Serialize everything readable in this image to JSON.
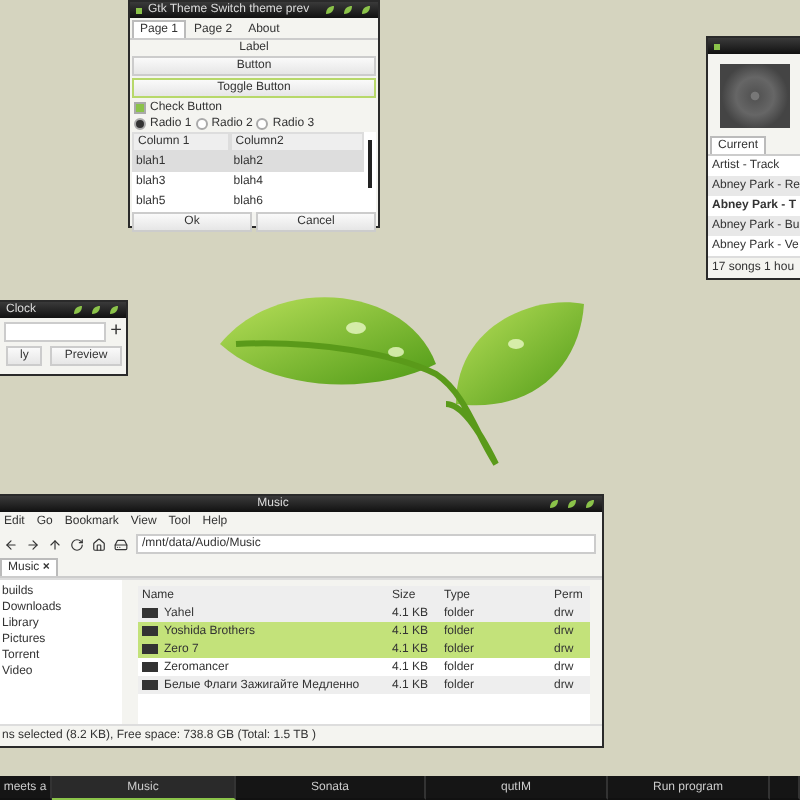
{
  "theme_preview": {
    "title": "Gtk Theme Switch theme prev",
    "tabs": [
      {
        "label": "Page 1",
        "selected": true
      },
      {
        "label": "Page 2",
        "selected": false
      },
      {
        "label": "About",
        "selected": false
      }
    ],
    "label": "Label",
    "button": "Button",
    "toggle": {
      "label": "Toggle Button",
      "on": true
    },
    "check": {
      "label": "Check Button",
      "checked": true
    },
    "radios": [
      {
        "label": "Radio 1",
        "selected": true
      },
      {
        "label": "Radio 2",
        "selected": false
      },
      {
        "label": "Radio 3",
        "selected": false
      }
    ],
    "table": {
      "columns": [
        "Column 1",
        "Column2"
      ],
      "rows": [
        {
          "cells": [
            "blah1",
            "blah2"
          ],
          "selected": true
        },
        {
          "cells": [
            "blah3",
            "blah4"
          ],
          "selected": false
        },
        {
          "cells": [
            "blah5",
            "blah6"
          ],
          "selected": false
        }
      ]
    },
    "buttons": [
      "Ok",
      "Cancel"
    ]
  },
  "player": {
    "tab": "Current",
    "header": "Artist - Track",
    "rows": [
      {
        "text": "Abney Park - Re",
        "playing": false
      },
      {
        "text": "Abney Park - T",
        "playing": true
      },
      {
        "text": "Abney Park - Bu",
        "playing": false
      },
      {
        "text": "Abney Park - Ve",
        "playing": false
      }
    ],
    "footer": "17 songs  1 hou"
  },
  "clock": {
    "title": "Clock",
    "add": "+",
    "buttons": [
      "ly",
      "Preview"
    ]
  },
  "file_manager": {
    "title": "Music",
    "menu": [
      "Edit",
      "Go",
      "Bookmark",
      "View",
      "Tool",
      "Help"
    ],
    "path": "/mnt/data/Audio/Music",
    "tabs": [
      {
        "label": "Music",
        "close": "×",
        "selected": true
      }
    ],
    "places": [
      "builds",
      "Downloads",
      "Library",
      "Pictures",
      "Torrent",
      "Video"
    ],
    "columns": [
      "Name",
      "Size",
      "Type",
      "Perm"
    ],
    "files": [
      {
        "name": "Yahel",
        "size": "4.1 KB",
        "type": "folder",
        "perm": "drw",
        "selected": false
      },
      {
        "name": "Yoshida Brothers",
        "size": "4.1 KB",
        "type": "folder",
        "perm": "drw",
        "selected": true
      },
      {
        "name": "Zero 7",
        "size": "4.1 KB",
        "type": "folder",
        "perm": "drw",
        "selected": true
      },
      {
        "name": "Zeromancer",
        "size": "4.1 KB",
        "type": "folder",
        "perm": "drw",
        "selected": false
      },
      {
        "name": "Белые Флаги Зажигайте Медленно",
        "size": "4.1 KB",
        "type": "folder",
        "perm": "drw",
        "selected": false
      }
    ],
    "status": "ns selected (8.2 KB), Free space: 738.8 GB (Total: 1.5 TB )"
  },
  "taskbar": [
    {
      "label": "meets a",
      "active": false
    },
    {
      "label": "Music",
      "active": true
    },
    {
      "label": "Sonata",
      "active": false
    },
    {
      "label": "qutIM",
      "active": false
    },
    {
      "label": "Run program",
      "active": false
    }
  ]
}
